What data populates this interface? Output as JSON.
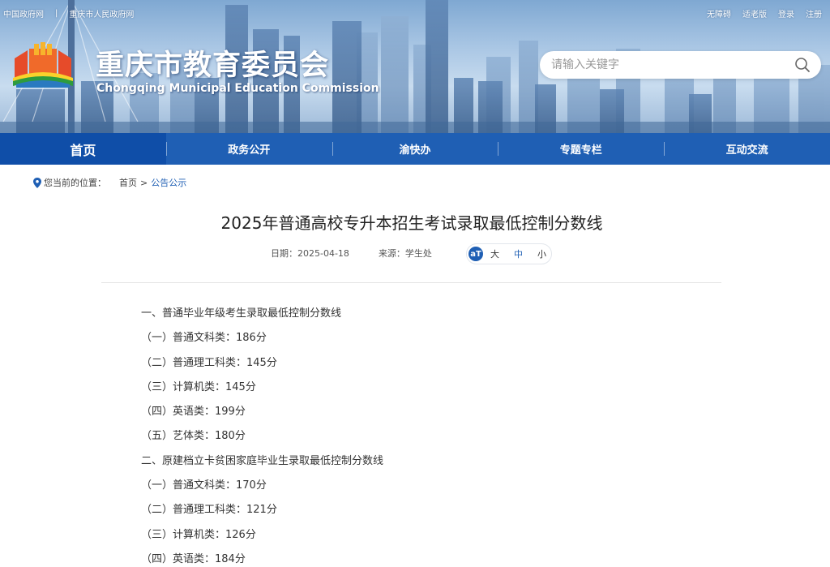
{
  "top_links_left": [
    "中国政府网",
    "|",
    "重庆市人民政府网"
  ],
  "top_links_right": [
    "无障碍",
    "适老版",
    "登录",
    "注册"
  ],
  "site": {
    "title": "重庆市教育委员会",
    "subtitle": "Chongqing Municipal Education Commission"
  },
  "search": {
    "placeholder": "请输入关键字",
    "icon": "search-icon"
  },
  "nav": {
    "items": [
      "首页",
      "政务公开",
      "渝快办",
      "专题专栏",
      "互动交流"
    ],
    "active": "首页"
  },
  "breadcrumb": {
    "label": "您当前的位置：",
    "items": [
      "首页",
      ">",
      "公告公示"
    ]
  },
  "article": {
    "title": "2025年普通高校专升本招生考试录取最低控制分数线",
    "date": "日期：2025-04-18",
    "source": "来源：学生处",
    "font_sizes": [
      "大",
      "中",
      "小"
    ],
    "font_icon": "aT",
    "lines": [
      "一、普通毕业年级考生录取最低控制分数线",
      "（一）普通文科类：186分",
      "（二）普通理工科类：145分",
      "（三）计算机类：145分",
      "（四）英语类：199分",
      "（五）艺体类：180分",
      "二、原建档立卡贫困家庭毕业生录取最低控制分数线",
      "（一）普通文科类：170分",
      "（二）普通理工科类：121分",
      "（三）计算机类：126分",
      "（四）英语类：184分"
    ]
  },
  "colors": {
    "nav_bg": "#1f5fb4",
    "nav_active": "#0f4ea8",
    "link": "#1f5fb4"
  }
}
